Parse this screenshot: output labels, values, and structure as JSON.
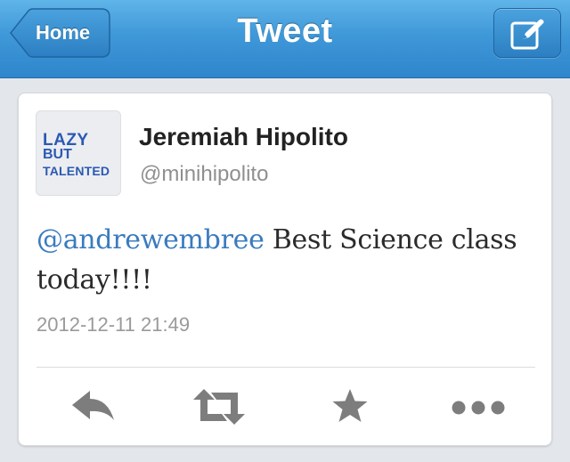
{
  "navbar": {
    "back_label": "Home",
    "title": "Tweet",
    "compose_icon": "compose-icon"
  },
  "tweet": {
    "avatar_lines": [
      "LAZY",
      "BUT",
      "TALENTED"
    ],
    "display_name": "Jeremiah Hipolito",
    "handle": "@minihipolito",
    "mention": "@andrewembree",
    "text": " Best Science class today!!!!",
    "timestamp": "2012-12-11 21:49"
  },
  "actions": {
    "icons": [
      "reply-icon",
      "retweet-icon",
      "star-icon",
      "more-icon"
    ]
  },
  "colors": {
    "navbar": "#3f98d8",
    "mention": "#3a7bbf",
    "avatar_text": "#2b59b3",
    "action_icon": "#7d7d7d"
  }
}
